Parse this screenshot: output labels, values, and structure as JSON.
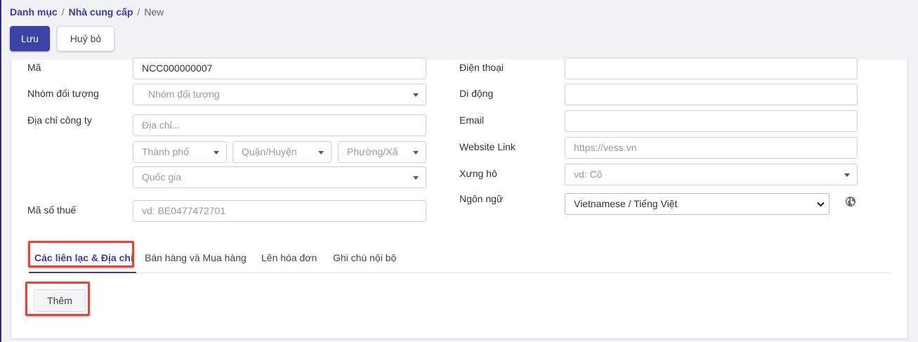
{
  "breadcrumb": {
    "item1": "Danh mục",
    "item2": "Nhà cung cấp",
    "current": "New",
    "separator": "/"
  },
  "actions": {
    "save_label": "Lưu",
    "cancel_label": "Huỷ bỏ"
  },
  "form": {
    "code_label": "Mã",
    "code_value": "NCC000000007",
    "group_label": "Nhóm đối tượng",
    "group_placeholder": "Nhóm đối tượng",
    "address_label": "Địa chỉ công ty",
    "address_placeholder": "Địa chỉ...",
    "city_placeholder": "Thành phố",
    "district_placeholder": "Quận/Huyện",
    "ward_placeholder": "Phường/Xã",
    "country_placeholder": "Quốc gia",
    "tax_label": "Mã số thuế",
    "tax_placeholder": "vd: BE0477472701",
    "phone_label": "Điện thoại",
    "phone_value": "",
    "mobile_label": "Di động",
    "mobile_value": "",
    "email_label": "Email",
    "email_value": "",
    "website_label": "Website Link",
    "website_placeholder": "https://vess.vn",
    "title_label": "Xưng hô",
    "title_placeholder": "vd: Cô",
    "language_label": "Ngôn ngữ",
    "language_value": "Vietnamese / Tiếng Việt",
    "language_icon": "globe-icon"
  },
  "tabs": [
    {
      "label": "Các liên lạc & Địa chỉ",
      "active": true
    },
    {
      "label": "Bán hàng và Mua hàng",
      "active": false
    },
    {
      "label": "Lên hóa đơn",
      "active": false
    },
    {
      "label": "Ghi chú nội bộ",
      "active": false
    }
  ],
  "contacts": {
    "add_label": "Thêm"
  },
  "colors": {
    "primary": "#3b43a6",
    "highlight": "#e0463c"
  }
}
